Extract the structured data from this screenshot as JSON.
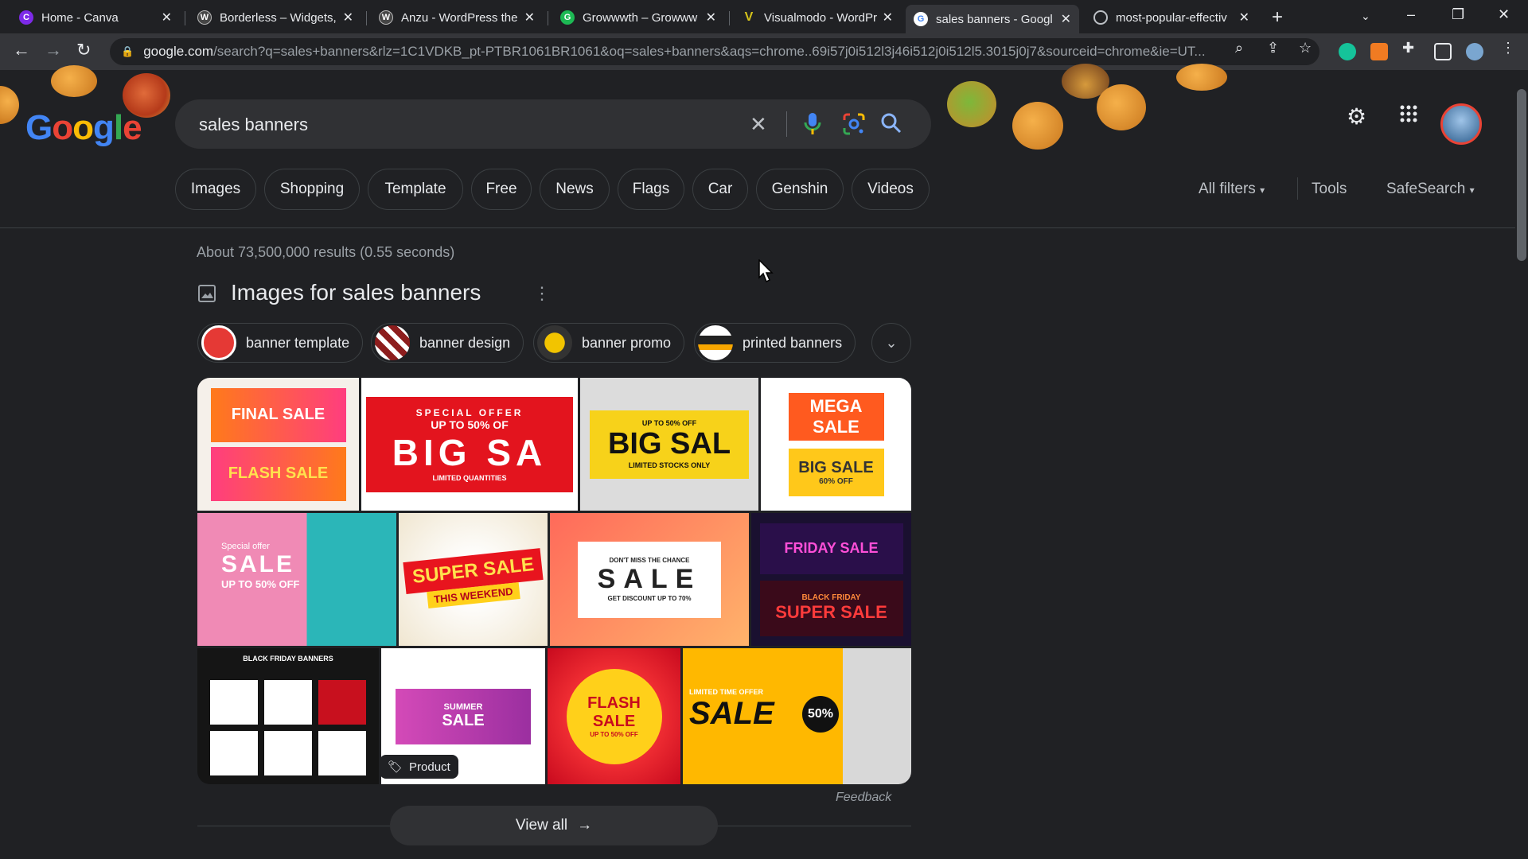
{
  "browser": {
    "tabs": [
      {
        "label": "Home - Canva",
        "favicon": "C",
        "color": "#7d2ae8"
      },
      {
        "label": "Borderless – Widgets,",
        "favicon": "W",
        "color": "#464646"
      },
      {
        "label": "Anzu - WordPress the",
        "favicon": "W",
        "color": "#464646"
      },
      {
        "label": "Growwwth – Growww",
        "favicon": "G",
        "color": "#1db954"
      },
      {
        "label": "Visualmodo - WordPr",
        "favicon": "V",
        "color": "#d4c21a"
      },
      {
        "label": "sales banners - Googl",
        "favicon": "G",
        "color": "#4285f4"
      },
      {
        "label": "most-popular-effectiv",
        "favicon": "◎",
        "color": "#5f6368"
      }
    ],
    "url_host": "google.com",
    "url_rest": "/search?q=sales+banners&rlz=1C1VDKB_pt-PTBR1061BR1061&oq=sales+banners&aqs=chrome..69i57j0i512l3j46i512j0i512l5.3015j0j7&sourceid=chrome&ie=UT..."
  },
  "google": {
    "logo": "Google",
    "query": "sales banners",
    "filters": [
      "Images",
      "Shopping",
      "Template",
      "Free",
      "News",
      "Flags",
      "Car",
      "Genshin",
      "Videos"
    ],
    "right_tools": {
      "all_filters": "All filters",
      "tools": "Tools",
      "safesearch": "SafeSearch"
    },
    "stats": "About 73,500,000 results (0.55 seconds)"
  },
  "images_section": {
    "title": "Images for sales banners",
    "related": [
      {
        "label": "banner template",
        "thumb_color": "#e53935"
      },
      {
        "label": "banner design",
        "thumb_color": "#8d1d1d"
      },
      {
        "label": "banner promo",
        "thumb_color": "#f2c400"
      },
      {
        "label": "printed banners",
        "thumb_color": "#ffffff"
      }
    ],
    "tiles": [
      {
        "line1": "FINAL SALE",
        "line2": "FLASH SALE"
      },
      {
        "line1": "SPECIAL OFFER",
        "line2": "UP TO 50% OF",
        "line3": "BIG SA",
        "line4": "LIMITED QUANTITIES"
      },
      {
        "line1": "UP TO 50% OFF",
        "line2": "BIG SAL",
        "line3": "LIMITED STOCKS ONLY"
      },
      {
        "line1": "MEGA SALE",
        "line2": "BIG SALE",
        "line3": "60% OFF"
      },
      {
        "line1": "Special offer",
        "line2": "SALE",
        "line3": "UP TO 50% OFF"
      },
      {
        "line1": "SUPER SALE",
        "line2": "THIS WEEKEND"
      },
      {
        "line1": "DON'T MISS THE CHANCE",
        "line2": "SALE",
        "line3": "GET DISCOUNT UP TO 70%"
      },
      {
        "line1": "FRIDAY SALE",
        "line2": "BLACK FRIDAY",
        "line3": "SUPER SALE"
      },
      {
        "line1": "BLACK FRIDAY BANNERS"
      },
      {
        "line1": "SUMMER",
        "line2": "SALE"
      },
      {
        "line1": "FLASH",
        "line2": "SALE",
        "line3": "UP TO 50% OFF"
      },
      {
        "line1": "LIMITED TIME OFFER",
        "line2": "SALE",
        "line3": "50%"
      }
    ],
    "product_tag": "Product",
    "feedback": "Feedback",
    "view_all": "View all"
  }
}
